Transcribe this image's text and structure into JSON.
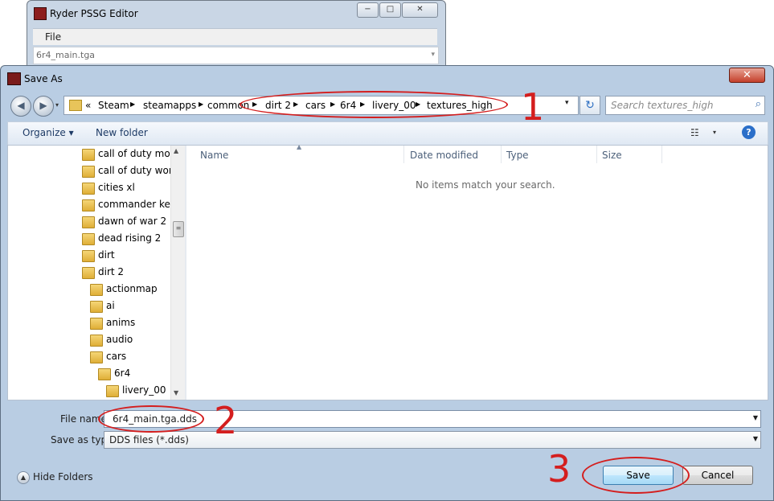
{
  "background_window": {
    "title": "Ryder PSSG Editor",
    "menu_file": "File",
    "texture_select_value": "6r4_main.tga",
    "min_label": "−",
    "max_label": "□",
    "close_label": "✕"
  },
  "dialog": {
    "title": "Save As",
    "close_label": "✕"
  },
  "address": {
    "overflow": "«",
    "crumbs": [
      "Steam",
      "steamapps",
      "common",
      "dirt 2",
      "cars",
      "6r4",
      "livery_00",
      "textures_high"
    ]
  },
  "search": {
    "placeholder": "Search textures_high"
  },
  "toolbar": {
    "organize": "Organize ▾",
    "new_folder": "New folder"
  },
  "tree": {
    "items": [
      "call of duty mode",
      "call of duty world",
      "cities xl",
      "commander keen",
      "dawn of war 2",
      "dead rising 2",
      "dirt",
      "dirt 2",
      "actionmap",
      "ai",
      "anims",
      "audio",
      "cars",
      "6r4",
      "livery_00"
    ]
  },
  "columns": {
    "name": "Name",
    "date": "Date modified",
    "type": "Type",
    "size": "Size"
  },
  "empty_message": "No items match your search.",
  "file_name": {
    "label": "File name:",
    "value": "6r4_main.tga.dds"
  },
  "save_type": {
    "label": "Save as type:",
    "value": "DDS files (*.dds)"
  },
  "hide_folders": "Hide Folders",
  "buttons": {
    "save": "Save",
    "cancel": "Cancel"
  },
  "annotations": [
    "1",
    "2",
    "3"
  ],
  "colors": {
    "annotation_red": "#d41e1e",
    "dialog_frame": "#b9cde3",
    "folder_yellow": "#e8c45a"
  },
  "icons": {
    "back": "◀",
    "forward": "▶",
    "dropdown": "▾",
    "refresh": "↻",
    "search": "⌕",
    "view": "☷",
    "help": "?",
    "scroll_up": "▲",
    "scroll_down": "▼",
    "scroll_thumb": "≡",
    "hide_folders": "▲"
  }
}
